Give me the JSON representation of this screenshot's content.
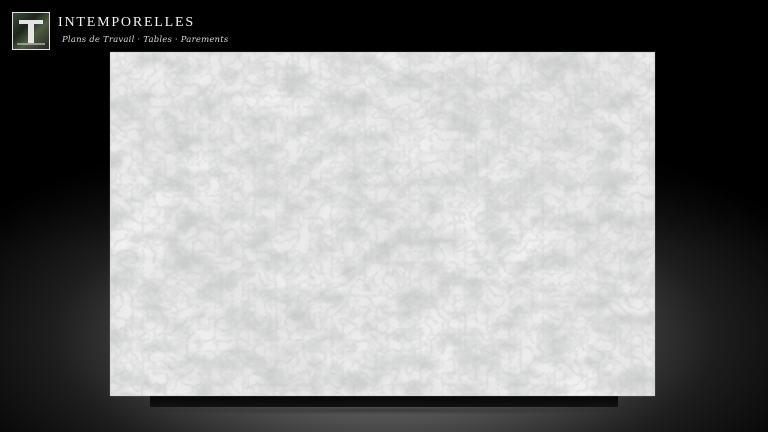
{
  "brand": {
    "name": "INTEMPORELLES",
    "tagline": "Plans de Travail · Tables · Parements",
    "logo_icon": "pillar-logo-icon"
  },
  "scene": {
    "subject": "white-quartz-slab-icon",
    "colors": {
      "slab_base": "#e4e5e4",
      "vein_dark": "#7a7c7c",
      "vein_light": "#ffffff",
      "stand": "#080808"
    }
  }
}
